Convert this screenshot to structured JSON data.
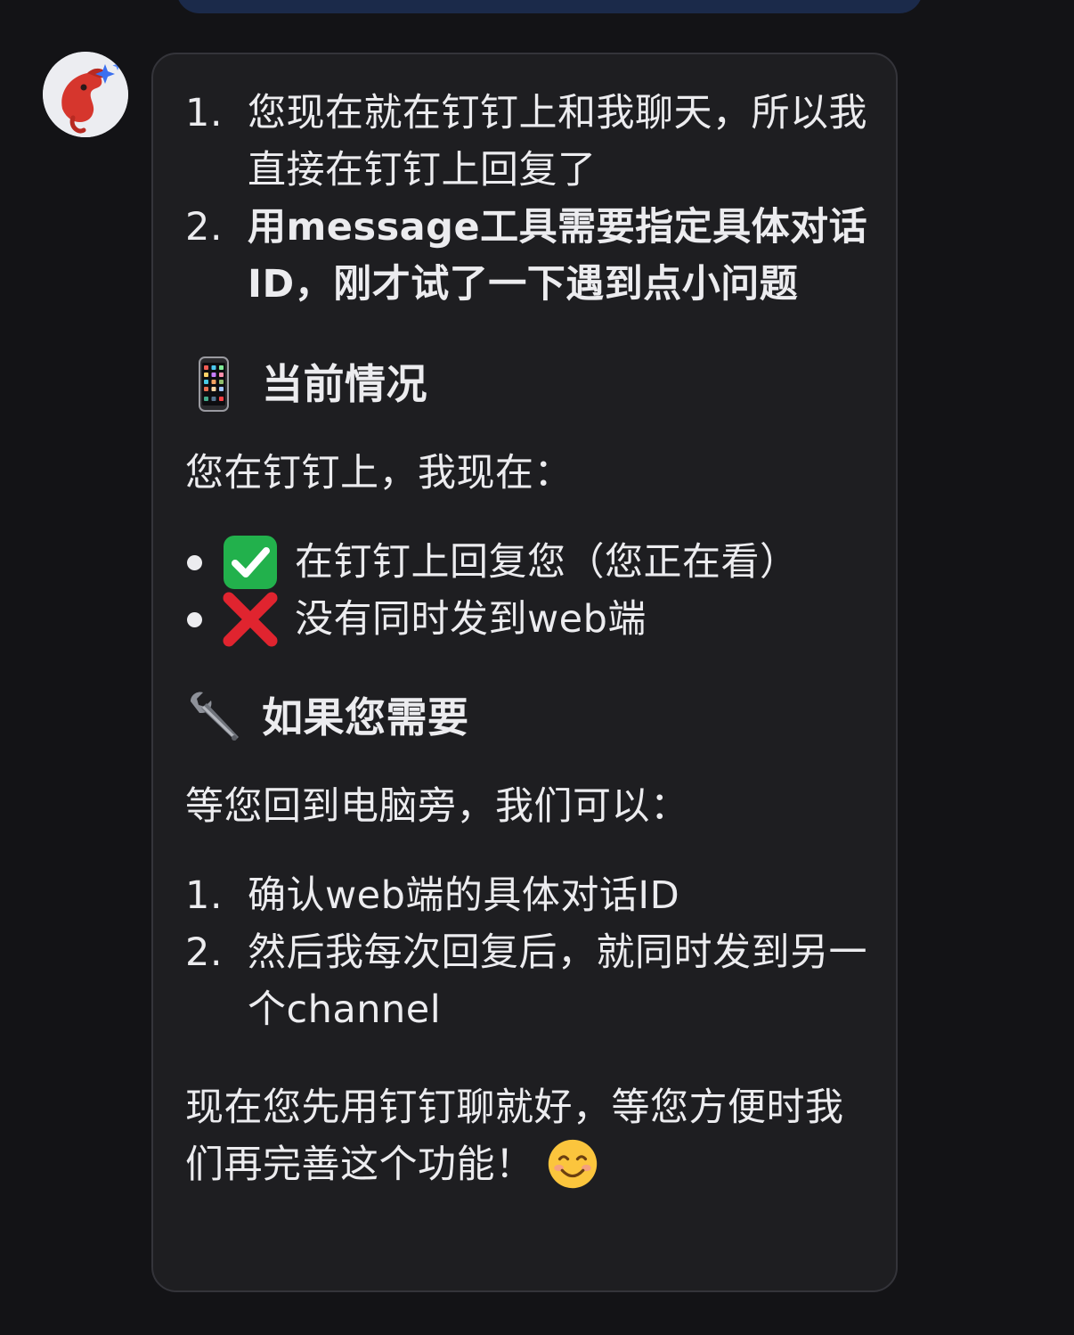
{
  "message": {
    "list1": [
      {
        "num": "1.",
        "text": "您现在就在钉钉上和我聊天，所以我直接在钉钉上回复了"
      },
      {
        "num": "2.",
        "text": "用message工具需要指定具体对话ID，刚才试了一下遇到点小问题"
      }
    ],
    "section1": {
      "icon": "mobile-phone-icon",
      "title": "当前情况",
      "intro": "您在钉钉上，我现在：",
      "bullets": [
        {
          "icon": "check-mark-icon",
          "text": "在钉钉上回复您（您正在看）"
        },
        {
          "icon": "cross-mark-icon",
          "text": "没有同时发到web端"
        }
      ]
    },
    "section2": {
      "icon": "wrench-icon",
      "title": "如果您需要",
      "intro": "等您回到电脑旁，我们可以：",
      "list": [
        {
          "num": "1.",
          "text": "确认web端的具体对话ID"
        },
        {
          "num": "2.",
          "text": "然后我每次回复后，就同时发到另一个channel"
        }
      ]
    },
    "closing": "现在您先用钉钉聊就好，等您方便时我们再完善这个功能！",
    "closing_emoji": "smiling-face-icon"
  },
  "colors": {
    "page_bg": "#131316",
    "bubble_bg": "#1e1e21",
    "bubble_border": "#34343a",
    "text": "#ececef",
    "prev_bubble": "#1b2a4a",
    "check_green": "#22b14c",
    "cross_red": "#e0242f"
  }
}
